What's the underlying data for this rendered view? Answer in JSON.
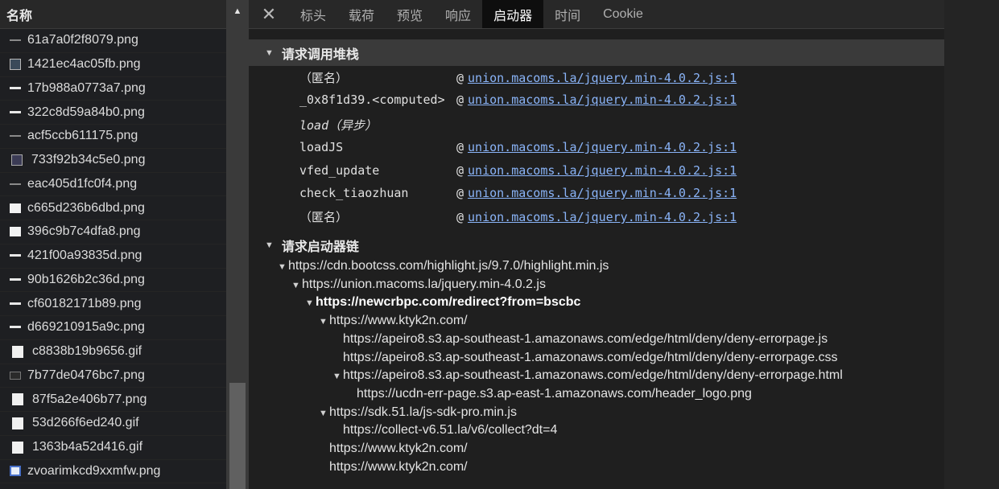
{
  "left": {
    "header_title": "名称",
    "files": [
      {
        "name": "61a7a0f2f8079.png",
        "icon": "line-icon"
      },
      {
        "name": "1421ec4ac05fb.png",
        "icon": "image-thumb-icon"
      },
      {
        "name": "17b988a0773a7.png",
        "icon": "line-bright-icon"
      },
      {
        "name": "322c8d59a84b0.png",
        "icon": "line-bright-icon"
      },
      {
        "name": "acf5ccb611175.png",
        "icon": "line-icon"
      },
      {
        "name": "733f92b34c5e0.png",
        "icon": "phone-thumb-icon"
      },
      {
        "name": "eac405d1fc0f4.png",
        "icon": "line-icon"
      },
      {
        "name": "c665d236b6dbd.png",
        "icon": "white-square-icon"
      },
      {
        "name": "396c9b7c4dfa8.png",
        "icon": "white-square-icon"
      },
      {
        "name": "421f00a93835d.png",
        "icon": "line-bright-icon"
      },
      {
        "name": "90b1626b2c36d.png",
        "icon": "line-bright-icon"
      },
      {
        "name": "cf60182171b89.png",
        "icon": "line-bright-icon"
      },
      {
        "name": "d669210915a9c.png",
        "icon": "line-bright-icon"
      },
      {
        "name": "c8838b19b9656.gif",
        "icon": "tall-white-icon"
      },
      {
        "name": "7b77de0476bc7.png",
        "icon": "dark-box-icon"
      },
      {
        "name": "87f5a2e406b77.png",
        "icon": "tall-white-icon"
      },
      {
        "name": "53d266f6ed240.gif",
        "icon": "tall-white-icon"
      },
      {
        "name": "1363b4a52d416.gif",
        "icon": "tall-white-icon"
      },
      {
        "name": "zvoarimkcd9xxmfw.png",
        "icon": "qr-code-icon"
      }
    ]
  },
  "tabs": {
    "close_label": "✕",
    "items": [
      "标头",
      "载荷",
      "预览",
      "响应",
      "启动器",
      "时间",
      "Cookie"
    ],
    "active": "启动器"
  },
  "stack": {
    "title": "请求调用堆栈",
    "at_symbol": "@",
    "rows": [
      {
        "fn": "（匿名）",
        "link": "union.macoms.la/jquery.min-4.0.2.js:1"
      },
      {
        "fn": "_0x8f1d39.<computed>",
        "link": "union.macoms.la/jquery.min-4.0.2.js:1"
      },
      {
        "fn": "load（异步）",
        "link": ""
      },
      {
        "fn": "loadJS",
        "link": "union.macoms.la/jquery.min-4.0.2.js:1"
      },
      {
        "fn": "vfed_update",
        "link": "union.macoms.la/jquery.min-4.0.2.js:1"
      },
      {
        "fn": "check_tiaozhuan",
        "link": "union.macoms.la/jquery.min-4.0.2.js:1"
      },
      {
        "fn": "（匿名）",
        "link": "union.macoms.la/jquery.min-4.0.2.js:1"
      }
    ]
  },
  "chain": {
    "title": "请求启动器链",
    "rows": [
      {
        "text": "https://cdn.bootcss.com/highlight.js/9.7.0/highlight.min.js",
        "depth": 0,
        "expanded": true,
        "bold": false
      },
      {
        "text": "https://union.macoms.la/jquery.min-4.0.2.js",
        "depth": 1,
        "expanded": true,
        "bold": false
      },
      {
        "text": "https://newcrbpc.com/redirect?from=bscbc",
        "depth": 2,
        "expanded": true,
        "bold": true
      },
      {
        "text": "https://www.ktyk2n.com/",
        "depth": 3,
        "expanded": true,
        "bold": false
      },
      {
        "text": "https://apeiro8.s3.ap-southeast-1.amazonaws.com/edge/html/deny/deny-errorpage.js",
        "depth": 4,
        "expanded": false,
        "bold": false
      },
      {
        "text": "https://apeiro8.s3.ap-southeast-1.amazonaws.com/edge/html/deny/deny-errorpage.css",
        "depth": 4,
        "expanded": false,
        "bold": false
      },
      {
        "text": "https://apeiro8.s3.ap-southeast-1.amazonaws.com/edge/html/deny/deny-errorpage.html",
        "depth": 4,
        "expanded": true,
        "bold": false
      },
      {
        "text": "https://ucdn-err-page.s3.ap-east-1.amazonaws.com/header_logo.png",
        "depth": 5,
        "expanded": false,
        "bold": false
      },
      {
        "text": "https://sdk.51.la/js-sdk-pro.min.js",
        "depth": 3,
        "expanded": true,
        "bold": false
      },
      {
        "text": "https://collect-v6.51.la/v6/collect?dt=4",
        "depth": 4,
        "expanded": false,
        "bold": false
      },
      {
        "text": "https://www.ktyk2n.com/",
        "depth": 3,
        "expanded": false,
        "bold": false
      },
      {
        "text": "https://www.ktyk2n.com/",
        "depth": 3,
        "expanded": false,
        "bold": false
      }
    ]
  }
}
